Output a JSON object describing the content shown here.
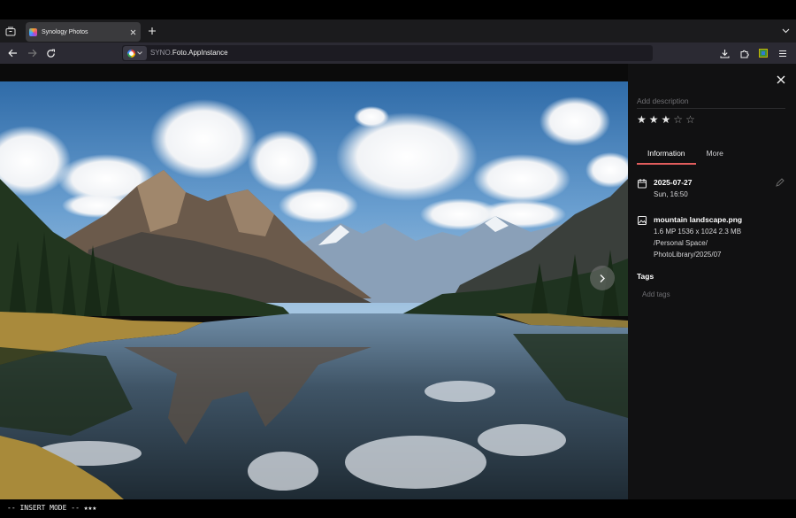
{
  "browser": {
    "tab": {
      "title": "Synology Photos",
      "favicon": "synology-photos-logo"
    },
    "url": {
      "prefix": "SYNO.",
      "main": "Foto.AppInstance"
    },
    "icons": {
      "tab_overview": "tab-overview-icon",
      "new_tab": "plus-icon",
      "list_tabs": "chevron-down-icon",
      "back": "arrow-left-icon",
      "forward": "arrow-right-icon",
      "reload": "reload-icon",
      "downloads": "download-icon",
      "extensions": "puzzle-icon",
      "menu": "hamburger-icon"
    }
  },
  "viewer": {
    "next_button_icon": "chevron-right-icon",
    "close_icon": "close-icon",
    "image_alt": "mountain landscape.png"
  },
  "panel": {
    "description_placeholder": "Add description",
    "rating": 3,
    "rating_max": 5,
    "tabs": [
      {
        "label": "Information",
        "active": true
      },
      {
        "label": "More",
        "active": false
      }
    ],
    "date": {
      "date": "2025-07-27",
      "time": "Sun, 16:50"
    },
    "file": {
      "name": "mountain landscape.png",
      "details": "1.6 MP  1536 x 1024  2.3 MB",
      "path_line1": "/Personal Space/",
      "path_line2": "PhotoLibrary/2025/07"
    },
    "tags_title": "Tags",
    "tags_placeholder": "Add tags"
  },
  "status": {
    "mode_text": "-- INSERT MODE -- ★★★"
  },
  "colors": {
    "accent": "#e15d5d",
    "panel_bg": "#111112",
    "toolbar_bg": "#2b2a33"
  }
}
